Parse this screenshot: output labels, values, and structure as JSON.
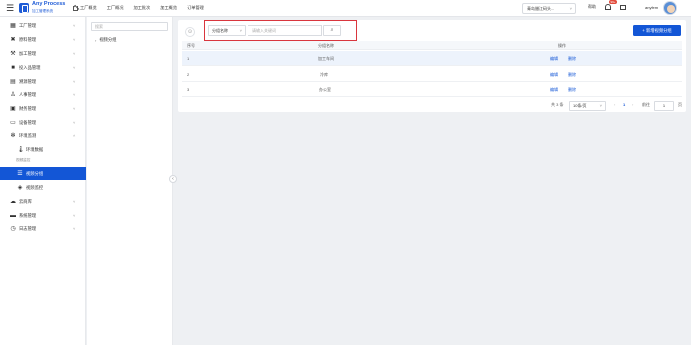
{
  "header": {
    "logo_title": "Any Process",
    "logo_subtitle": "加工管理系统",
    "nav": [
      "工厂概览",
      "工厂概况",
      "加工批次",
      "加工概览",
      "订单管理"
    ],
    "factory_select": "青岛腊江码头...",
    "help": "帮助",
    "badge": "99+",
    "username": "anyfem"
  },
  "sidebar": {
    "items": [
      {
        "label": "工厂管理",
        "icon": "grid-icon",
        "arrow": "˅"
      },
      {
        "label": "原料管理",
        "icon": "cross-icon",
        "arrow": "˅"
      },
      {
        "label": "加工管理",
        "icon": "hammer-icon",
        "arrow": "˅"
      },
      {
        "label": "投入品管理",
        "icon": "briefcase-icon",
        "arrow": "˅"
      },
      {
        "label": "溯源管理",
        "icon": "layers-icon",
        "arrow": "˅"
      },
      {
        "label": "人事管理",
        "icon": "people-icon",
        "arrow": "˅"
      },
      {
        "label": "财务管理",
        "icon": "wallet-icon",
        "arrow": "˅"
      },
      {
        "label": "设备管理",
        "icon": "monitor-icon",
        "arrow": "˅"
      },
      {
        "label": "环境监测",
        "icon": "snowflake-icon",
        "arrow": "˄"
      }
    ],
    "env_data": "环境数据",
    "group_label": "视频监控",
    "video_group": "视频分组",
    "video_monitor": "视频监控",
    "bottom_items": [
      {
        "label": "云商库",
        "icon": "cloud-icon",
        "arrow": "˅"
      },
      {
        "label": "系统管理",
        "icon": "truck-icon",
        "arrow": "˅"
      },
      {
        "label": "日志管理",
        "icon": "clock-icon",
        "arrow": "˅"
      }
    ]
  },
  "tree": {
    "search_placeholder": "搜索",
    "root": "视频分组"
  },
  "filter": {
    "field": "分组名称",
    "placeholder": "请输入关键词",
    "add_button": "+ 新增视频分组"
  },
  "table": {
    "headers": [
      "序号",
      "分组名称",
      "操作"
    ],
    "rows": [
      {
        "index": "1",
        "name": "加工车间",
        "edit": "编辑",
        "delete": "删除"
      },
      {
        "index": "2",
        "name": "冷库",
        "edit": "编辑",
        "delete": "删除"
      },
      {
        "index": "3",
        "name": "办公室",
        "edit": "编辑",
        "delete": "删除"
      }
    ]
  },
  "pager": {
    "total": "共 3 条",
    "page_size": "10条/页",
    "prev": "‹",
    "current": "1",
    "next": "›",
    "goto_label": "前往",
    "goto_value": "1",
    "goto_suffix": "页"
  }
}
